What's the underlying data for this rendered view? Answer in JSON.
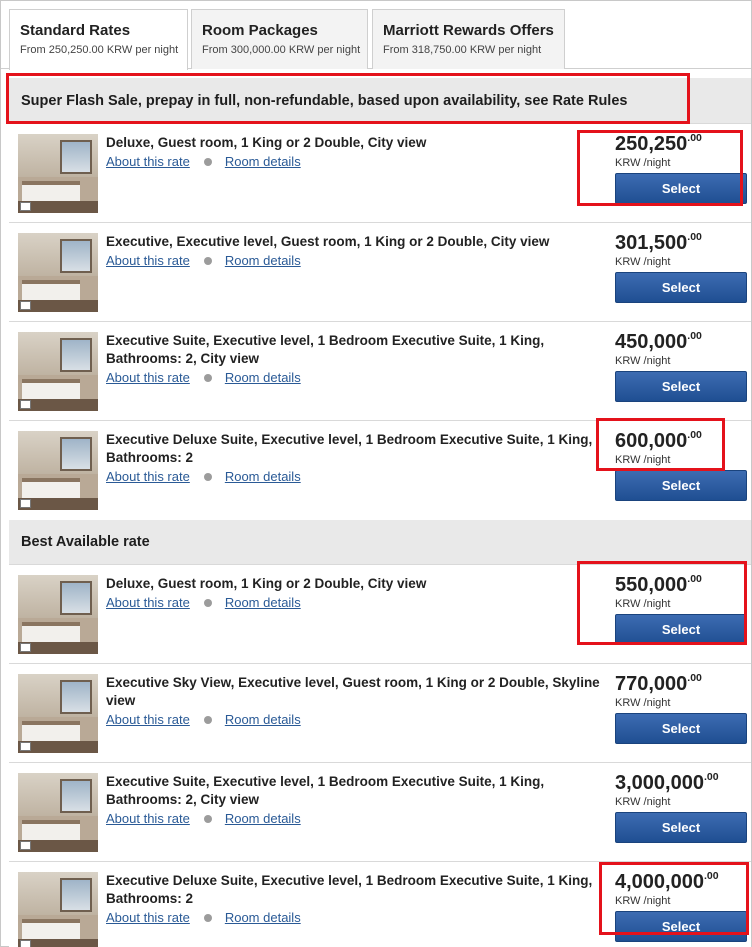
{
  "tabs": [
    {
      "title": "Standard Rates",
      "subtitle": "From 250,250.00 KRW per night"
    },
    {
      "title": "Room Packages",
      "subtitle": "From 300,000.00 KRW per night"
    },
    {
      "title": "Marriott Rewards Offers",
      "subtitle": "From 318,750.00 KRW per night"
    }
  ],
  "sections": [
    {
      "title": "Super Flash Sale, prepay in full, non-refundable, based upon availability, see Rate Rules"
    },
    {
      "title": "Best Available rate"
    }
  ],
  "labels": {
    "about_rate": "About this rate",
    "room_details": "Room details",
    "select": "Select",
    "unit": "KRW /night"
  },
  "rooms": [
    {
      "title": "Deluxe, Guest room, 1 King or 2 Double, City view",
      "price": "250,250",
      "cents": ".00"
    },
    {
      "title": "Executive, Executive level, Guest room, 1 King or 2 Double, City view",
      "price": "301,500",
      "cents": ".00"
    },
    {
      "title": "Executive Suite, Executive level, 1 Bedroom Executive Suite, 1 King, Bathrooms: 2, City view",
      "price": "450,000",
      "cents": ".00"
    },
    {
      "title": "Executive Deluxe Suite, Executive level, 1 Bedroom Executive Suite, 1 King, Bathrooms: 2",
      "price": "600,000",
      "cents": ".00"
    },
    {
      "title": "Deluxe, Guest room, 1 King or 2 Double, City view",
      "price": "550,000",
      "cents": ".00"
    },
    {
      "title": "Executive Sky View, Executive level, Guest room, 1 King or 2 Double, Skyline view",
      "price": "770,000",
      "cents": ".00"
    },
    {
      "title": "Executive Suite, Executive level, 1 Bedroom Executive Suite, 1 King, Bathrooms: 2, City view",
      "price": "3,000,000",
      "cents": ".00"
    },
    {
      "title": "Executive Deluxe Suite, Executive level, 1 Bedroom Executive Suite, 1 King, Bathrooms: 2",
      "price": "4,000,000",
      "cents": ".00"
    }
  ],
  "colors": {
    "highlight": "#e4121b",
    "button": "#2a5a9e",
    "link": "#2a5a96"
  }
}
